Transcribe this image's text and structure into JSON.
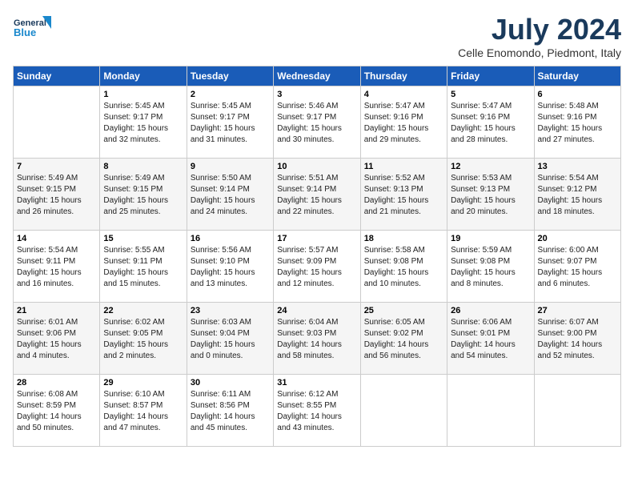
{
  "header": {
    "logo_line1": "General",
    "logo_line2": "Blue",
    "month_title": "July 2024",
    "location": "Celle Enomondo, Piedmont, Italy"
  },
  "days_of_week": [
    "Sunday",
    "Monday",
    "Tuesday",
    "Wednesday",
    "Thursday",
    "Friday",
    "Saturday"
  ],
  "weeks": [
    [
      {
        "num": "",
        "sunrise": "",
        "sunset": "",
        "daylight": ""
      },
      {
        "num": "1",
        "sunrise": "Sunrise: 5:45 AM",
        "sunset": "Sunset: 9:17 PM",
        "daylight": "Daylight: 15 hours and 32 minutes."
      },
      {
        "num": "2",
        "sunrise": "Sunrise: 5:45 AM",
        "sunset": "Sunset: 9:17 PM",
        "daylight": "Daylight: 15 hours and 31 minutes."
      },
      {
        "num": "3",
        "sunrise": "Sunrise: 5:46 AM",
        "sunset": "Sunset: 9:17 PM",
        "daylight": "Daylight: 15 hours and 30 minutes."
      },
      {
        "num": "4",
        "sunrise": "Sunrise: 5:47 AM",
        "sunset": "Sunset: 9:16 PM",
        "daylight": "Daylight: 15 hours and 29 minutes."
      },
      {
        "num": "5",
        "sunrise": "Sunrise: 5:47 AM",
        "sunset": "Sunset: 9:16 PM",
        "daylight": "Daylight: 15 hours and 28 minutes."
      },
      {
        "num": "6",
        "sunrise": "Sunrise: 5:48 AM",
        "sunset": "Sunset: 9:16 PM",
        "daylight": "Daylight: 15 hours and 27 minutes."
      }
    ],
    [
      {
        "num": "7",
        "sunrise": "Sunrise: 5:49 AM",
        "sunset": "Sunset: 9:15 PM",
        "daylight": "Daylight: 15 hours and 26 minutes."
      },
      {
        "num": "8",
        "sunrise": "Sunrise: 5:49 AM",
        "sunset": "Sunset: 9:15 PM",
        "daylight": "Daylight: 15 hours and 25 minutes."
      },
      {
        "num": "9",
        "sunrise": "Sunrise: 5:50 AM",
        "sunset": "Sunset: 9:14 PM",
        "daylight": "Daylight: 15 hours and 24 minutes."
      },
      {
        "num": "10",
        "sunrise": "Sunrise: 5:51 AM",
        "sunset": "Sunset: 9:14 PM",
        "daylight": "Daylight: 15 hours and 22 minutes."
      },
      {
        "num": "11",
        "sunrise": "Sunrise: 5:52 AM",
        "sunset": "Sunset: 9:13 PM",
        "daylight": "Daylight: 15 hours and 21 minutes."
      },
      {
        "num": "12",
        "sunrise": "Sunrise: 5:53 AM",
        "sunset": "Sunset: 9:13 PM",
        "daylight": "Daylight: 15 hours and 20 minutes."
      },
      {
        "num": "13",
        "sunrise": "Sunrise: 5:54 AM",
        "sunset": "Sunset: 9:12 PM",
        "daylight": "Daylight: 15 hours and 18 minutes."
      }
    ],
    [
      {
        "num": "14",
        "sunrise": "Sunrise: 5:54 AM",
        "sunset": "Sunset: 9:11 PM",
        "daylight": "Daylight: 15 hours and 16 minutes."
      },
      {
        "num": "15",
        "sunrise": "Sunrise: 5:55 AM",
        "sunset": "Sunset: 9:11 PM",
        "daylight": "Daylight: 15 hours and 15 minutes."
      },
      {
        "num": "16",
        "sunrise": "Sunrise: 5:56 AM",
        "sunset": "Sunset: 9:10 PM",
        "daylight": "Daylight: 15 hours and 13 minutes."
      },
      {
        "num": "17",
        "sunrise": "Sunrise: 5:57 AM",
        "sunset": "Sunset: 9:09 PM",
        "daylight": "Daylight: 15 hours and 12 minutes."
      },
      {
        "num": "18",
        "sunrise": "Sunrise: 5:58 AM",
        "sunset": "Sunset: 9:08 PM",
        "daylight": "Daylight: 15 hours and 10 minutes."
      },
      {
        "num": "19",
        "sunrise": "Sunrise: 5:59 AM",
        "sunset": "Sunset: 9:08 PM",
        "daylight": "Daylight: 15 hours and 8 minutes."
      },
      {
        "num": "20",
        "sunrise": "Sunrise: 6:00 AM",
        "sunset": "Sunset: 9:07 PM",
        "daylight": "Daylight: 15 hours and 6 minutes."
      }
    ],
    [
      {
        "num": "21",
        "sunrise": "Sunrise: 6:01 AM",
        "sunset": "Sunset: 9:06 PM",
        "daylight": "Daylight: 15 hours and 4 minutes."
      },
      {
        "num": "22",
        "sunrise": "Sunrise: 6:02 AM",
        "sunset": "Sunset: 9:05 PM",
        "daylight": "Daylight: 15 hours and 2 minutes."
      },
      {
        "num": "23",
        "sunrise": "Sunrise: 6:03 AM",
        "sunset": "Sunset: 9:04 PM",
        "daylight": "Daylight: 15 hours and 0 minutes."
      },
      {
        "num": "24",
        "sunrise": "Sunrise: 6:04 AM",
        "sunset": "Sunset: 9:03 PM",
        "daylight": "Daylight: 14 hours and 58 minutes."
      },
      {
        "num": "25",
        "sunrise": "Sunrise: 6:05 AM",
        "sunset": "Sunset: 9:02 PM",
        "daylight": "Daylight: 14 hours and 56 minutes."
      },
      {
        "num": "26",
        "sunrise": "Sunrise: 6:06 AM",
        "sunset": "Sunset: 9:01 PM",
        "daylight": "Daylight: 14 hours and 54 minutes."
      },
      {
        "num": "27",
        "sunrise": "Sunrise: 6:07 AM",
        "sunset": "Sunset: 9:00 PM",
        "daylight": "Daylight: 14 hours and 52 minutes."
      }
    ],
    [
      {
        "num": "28",
        "sunrise": "Sunrise: 6:08 AM",
        "sunset": "Sunset: 8:59 PM",
        "daylight": "Daylight: 14 hours and 50 minutes."
      },
      {
        "num": "29",
        "sunrise": "Sunrise: 6:10 AM",
        "sunset": "Sunset: 8:57 PM",
        "daylight": "Daylight: 14 hours and 47 minutes."
      },
      {
        "num": "30",
        "sunrise": "Sunrise: 6:11 AM",
        "sunset": "Sunset: 8:56 PM",
        "daylight": "Daylight: 14 hours and 45 minutes."
      },
      {
        "num": "31",
        "sunrise": "Sunrise: 6:12 AM",
        "sunset": "Sunset: 8:55 PM",
        "daylight": "Daylight: 14 hours and 43 minutes."
      },
      {
        "num": "",
        "sunrise": "",
        "sunset": "",
        "daylight": ""
      },
      {
        "num": "",
        "sunrise": "",
        "sunset": "",
        "daylight": ""
      },
      {
        "num": "",
        "sunrise": "",
        "sunset": "",
        "daylight": ""
      }
    ]
  ]
}
